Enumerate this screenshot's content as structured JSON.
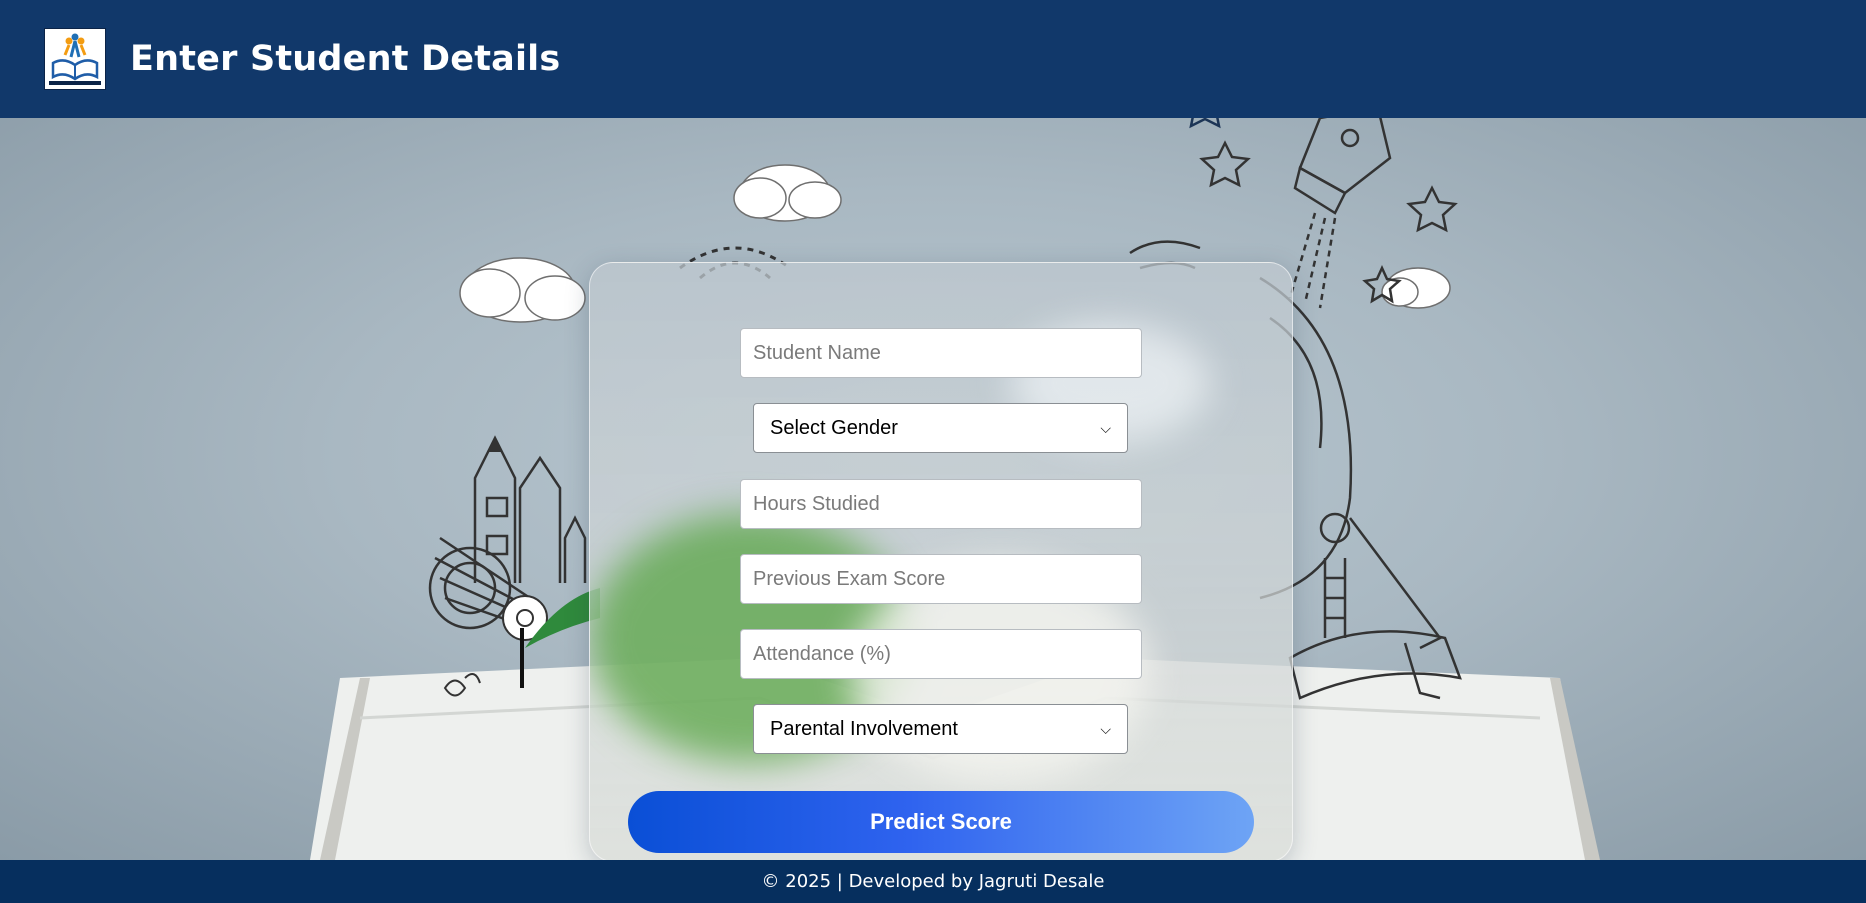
{
  "header": {
    "title": "Enter Student Details",
    "logo_icon": "education-book-logo-icon",
    "background": "#11386a"
  },
  "form": {
    "student_name_placeholder": "Student Name",
    "gender_select": {
      "selected": "Select Gender"
    },
    "hours_studied_placeholder": "Hours Studied",
    "previous_exam_score_placeholder": "Previous Exam Score",
    "attendance_placeholder": "Attendance (%)",
    "parental_involvement_select": {
      "selected": "Parental Involvement"
    },
    "submit_label": "Predict Score"
  },
  "footer": {
    "text": "© 2025 | Developed by Jagruti Desale",
    "background": "#062f5e"
  },
  "colors": {
    "button_gradient_start": "#0a4fd6",
    "button_gradient_end": "#6ea4f5"
  }
}
